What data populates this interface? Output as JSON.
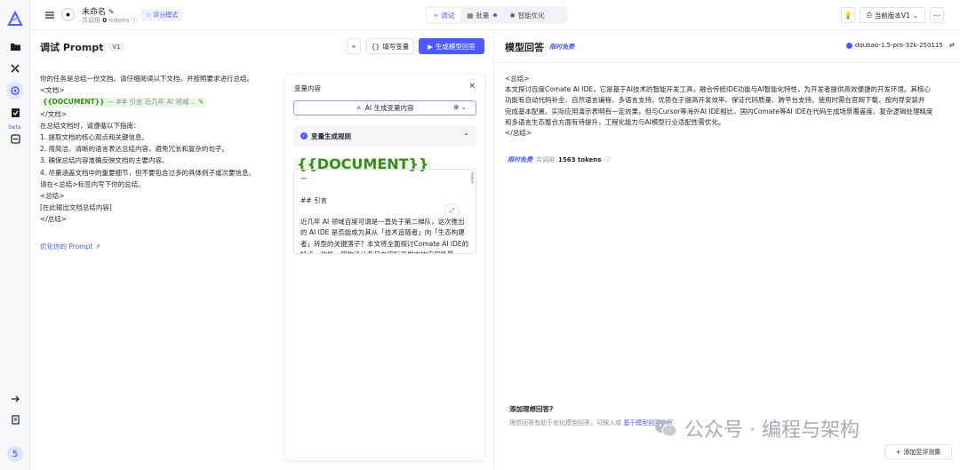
{
  "topbar": {
    "doc_name": "未命名",
    "doc_calls_prefix": "共调用",
    "doc_calls_count": "0",
    "doc_calls_suffix": "tokens",
    "score_mode": "评分模式",
    "tabs": [
      {
        "label": "调试",
        "active": true
      },
      {
        "label": "批量",
        "active": false
      },
      {
        "label": "智能优化",
        "active": false
      }
    ],
    "version_label": "当前版本V1"
  },
  "left": {
    "title": "调试 Prompt",
    "version_tag": "V1",
    "fill_var_label": "填写变量",
    "generate_label": "生成模型回答",
    "prompt_lines": [
      "你的任务是总结一份文档。请仔细阅读以下文档，并按照要求进行总结。",
      "<文档>",
      "__CHIP__",
      "</文档>",
      "在总结文档时，请遵循以下指南：",
      "1. 提取文档的核心观点和关键信息。",
      "2. 用简洁、清晰的语言表达总结内容，避免冗长和复杂的句子。",
      "3. 确保总结内容准确反映文档的主要内容。",
      "4. 尽量涵盖文档中的重要细节，但不要包含过多的具体例子或次要信息。",
      "请在<总结>标签内写下你的总结。",
      "<总结>",
      "[在此输出文档总结内容]",
      "</总结>"
    ],
    "doc_chip": "{{DOCUMENT}}",
    "doc_chip_ref": "— ## 引言 近几年 AI 领域…",
    "optimize_label": "优化你的 Prompt"
  },
  "var_panel": {
    "title": "变量内容",
    "ai_generate_label": "AI 生成变量内容",
    "rule_label": "变量生成规则",
    "var_chip": "{{DOCUMENT}}",
    "content_lines": [
      "—",
      "",
      "## 引言",
      "",
      "近几年 AI 领域百度可谓是一直处于第二梯队，这次推出",
      "的 AI IDE 是否能成为其从「技术追随者」向「生态构建",
      "者」转型的关键落子？本文将全面探讨Comate AI IDE的",
      "特点、功能、架构设计及其在实际开发中的应用场景。"
    ]
  },
  "right": {
    "title": "模型回答",
    "limited_badge": "限时免费",
    "model_name": "doubao-1.5-pro-32k-250115",
    "answer_lines": [
      "<总结>",
      "本文探讨百度Comate AI IDE，它是基于AI技术的智能开发工具，融合传统IDE功能与AI智能化特性，为开发者提供高效便捷的开发环境。其核心",
      "功能有自动代码补全、自然语言编程、多语言支持。优势在于提高开发效率、保证代码质量、跨平台支持。使用时需在官网下载，按向导安装并",
      "完成基本配置。实际应用演示表明有一定效果，但与Cursor等海外AI IDE相比，国内Comate等AI IDE在代码生成场景覆盖度、复杂逻辑处理精度",
      "和多语言生态整合方面有待提升，工程化能力与AI模型行业适配性需优化。",
      "</总结>"
    ],
    "call_prefix": "共调用",
    "call_tokens": "1563 tokens",
    "ideal_title": "添加理想回答?",
    "ideal_sub_text": "理想回答有助于优化模型回答，可输入或",
    "ideal_sub_link": "基于模型回答改写",
    "add_eval_label": "添加至评测集"
  },
  "rail": {
    "beta_label": "beta",
    "avatar_label": "5"
  },
  "watermark": {
    "text": "公众号 · 编程与架构"
  },
  "colors": {
    "accent": "#4d5bff",
    "chip_bg": "#eaf7e3",
    "chip_text": "#3a8a24"
  }
}
